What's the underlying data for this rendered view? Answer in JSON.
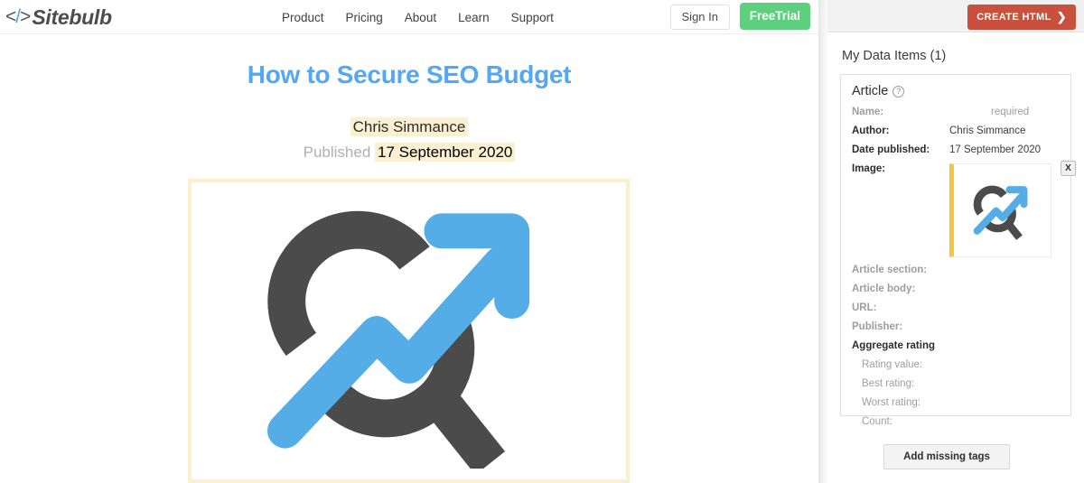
{
  "site": {
    "logo_text": "Sitebulb",
    "logo_icon": "code-brackets-icon",
    "nav": [
      {
        "label": "Product"
      },
      {
        "label": "Pricing"
      },
      {
        "label": "About"
      },
      {
        "label": "Learn"
      },
      {
        "label": "Support"
      }
    ],
    "sign_in_label": "Sign In",
    "free_trial_label": "FreeTrial"
  },
  "article": {
    "title": "How to Secure SEO Budget",
    "author": "Chris Simmance",
    "published_label": "Published",
    "published_date": "17 September 2020",
    "hero_image_alt": "magnifier-trend-arrow-icon"
  },
  "panel": {
    "create_html_label": "CREATE HTML",
    "create_html_chevron": "❯",
    "heading": "My Data Items (1)",
    "card": {
      "title": "Article",
      "help_icon": "question-mark-icon",
      "remove_image_label": "X",
      "fields": [
        {
          "label": "Name:",
          "value": "required",
          "state": "required"
        },
        {
          "label": "Author:",
          "value": "Chris Simmance",
          "state": "set"
        },
        {
          "label": "Date published:",
          "value": "17 September 2020",
          "state": "set"
        },
        {
          "label": "Image:",
          "value": "",
          "state": "image"
        },
        {
          "label": "Article section:",
          "value": "",
          "state": "empty"
        },
        {
          "label": "Article body:",
          "value": "",
          "state": "empty"
        },
        {
          "label": "URL:",
          "value": "",
          "state": "empty"
        },
        {
          "label": "Publisher:",
          "value": "",
          "state": "empty"
        }
      ],
      "group": {
        "label": "Aggregate rating",
        "items": [
          {
            "label": "Rating value:",
            "value": ""
          },
          {
            "label": "Best rating:",
            "value": ""
          },
          {
            "label": "Worst rating:",
            "value": ""
          },
          {
            "label": "Count:",
            "value": ""
          }
        ]
      }
    },
    "add_missing_tags_label": "Add missing tags"
  },
  "colors": {
    "title_blue": "#54a7f2",
    "highlight_yellow": "#fbf0d2",
    "hero_border": "#fbefcd",
    "thumb_accent": "#f7c63f",
    "green_cta": "#5dd07e",
    "red_cta": "#c8503c",
    "icon_blue": "#55ade8",
    "icon_dark": "#4b4b4b"
  }
}
